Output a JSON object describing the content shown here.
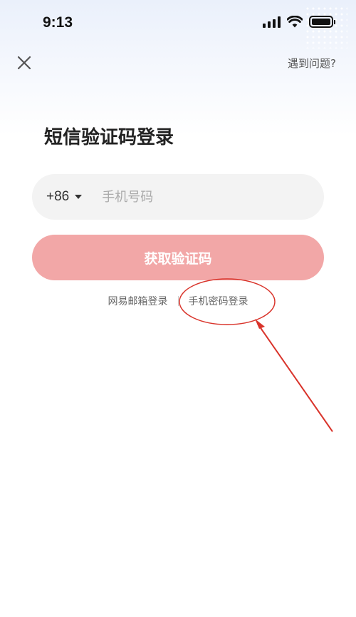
{
  "status_bar": {
    "time": "9:13",
    "signal_icon": "signal-bars-icon",
    "wifi_icon": "wifi-icon",
    "battery_icon": "battery-icon"
  },
  "nav": {
    "close_icon": "close-icon",
    "help_label": "遇到问题?"
  },
  "page_title": "短信验证码登录",
  "phone_form": {
    "country_code": "+86",
    "phone_placeholder": "手机号码",
    "phone_value": ""
  },
  "get_code_button": {
    "label": "获取验证码",
    "color": "#f2a7a7"
  },
  "alt_login": {
    "email_login_label": "网易邮箱登录",
    "password_login_label": "手机密码登录"
  },
  "annotation_color": "#d9342b"
}
